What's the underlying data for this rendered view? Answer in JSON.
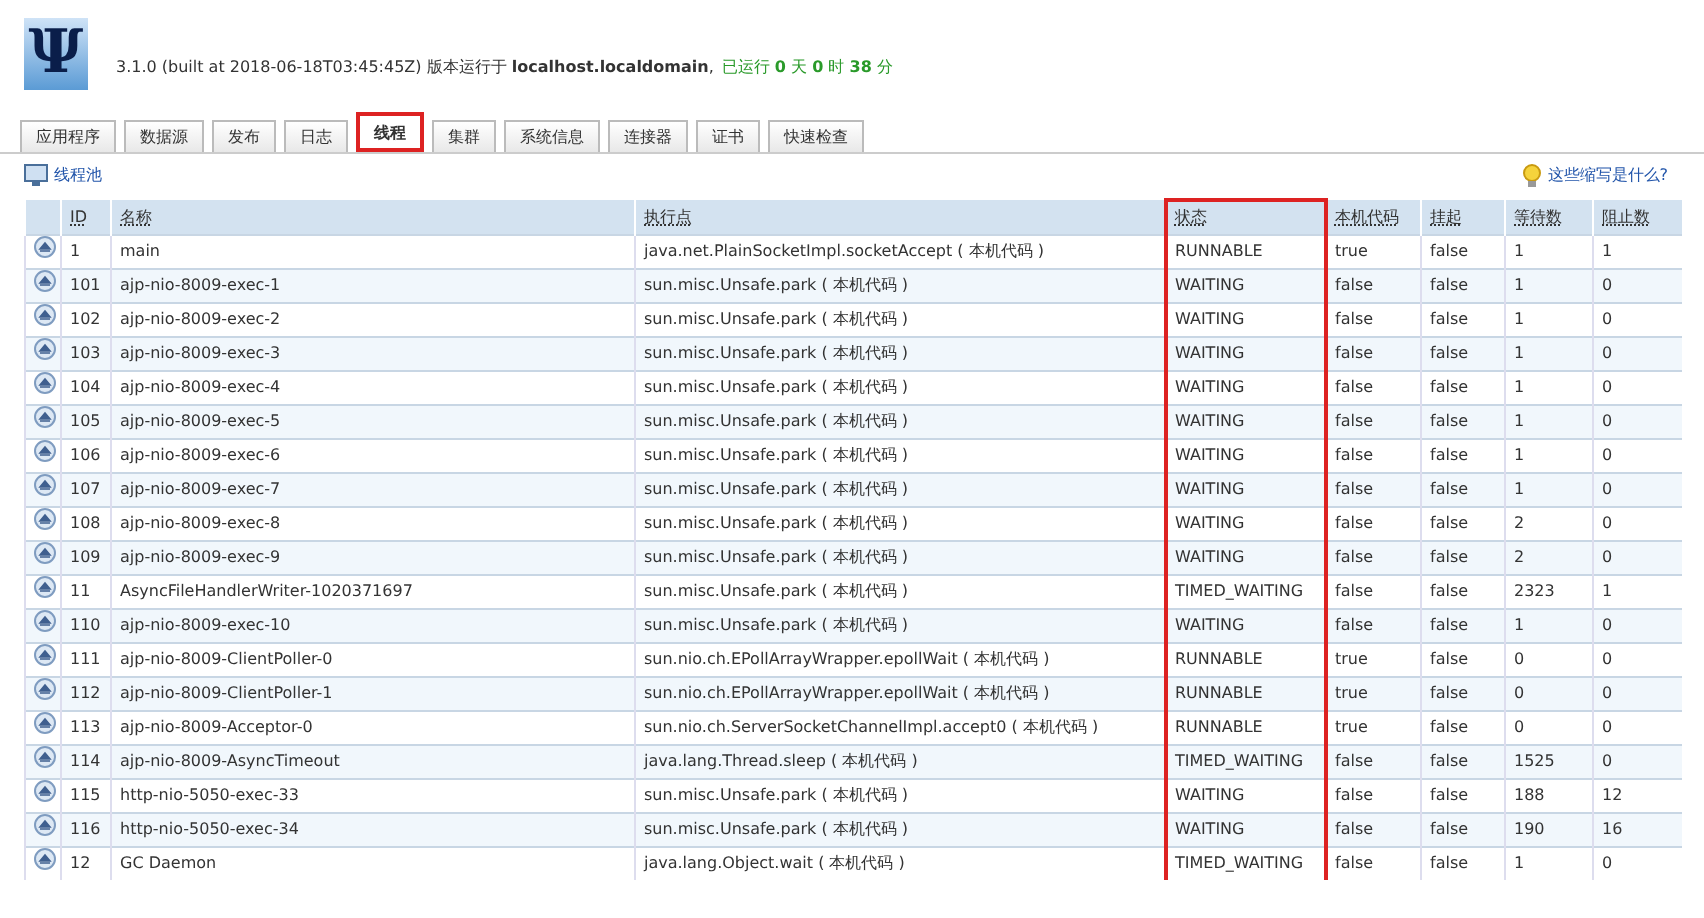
{
  "header": {
    "logo_glyph": "Ψ",
    "version": "3.1.0 (built at 2018-06-18T03:45:45Z) 版本运行于 **localhost.localdomain**,",
    "uptime": "已运行 **0** 天 **0** 时 **38** 分"
  },
  "tabs": [
    {
      "label": "应用程序",
      "selected": false
    },
    {
      "label": "数据源",
      "selected": false
    },
    {
      "label": "发布",
      "selected": false
    },
    {
      "label": "日志",
      "selected": false
    },
    {
      "label": "线程",
      "selected": true
    },
    {
      "label": "集群",
      "selected": false
    },
    {
      "label": "系统信息",
      "selected": false
    },
    {
      "label": "连接器",
      "selected": false
    },
    {
      "label": "证书",
      "selected": false
    },
    {
      "label": "快速检查",
      "selected": false
    }
  ],
  "toolbar": {
    "pool_link": "线程池",
    "help_link": "这些缩写是什么?"
  },
  "table": {
    "columns": [
      {
        "label": "ID",
        "highlighted": false
      },
      {
        "label": "名称",
        "highlighted": false
      },
      {
        "label": "执行点",
        "highlighted": false
      },
      {
        "label": "状态",
        "highlighted": true
      },
      {
        "label": "本机代码",
        "highlighted": false
      },
      {
        "label": "挂起",
        "highlighted": false
      },
      {
        "label": "等待数",
        "highlighted": false
      },
      {
        "label": "阻止数",
        "highlighted": false
      }
    ],
    "rows": [
      [
        "1",
        "main",
        "java.net.PlainSocketImpl.socketAccept ( 本机代码 )",
        "RUNNABLE",
        "true",
        "false",
        "1",
        "1"
      ],
      [
        "101",
        "ajp-nio-8009-exec-1",
        "sun.misc.Unsafe.park ( 本机代码 )",
        "WAITING",
        "false",
        "false",
        "1",
        "0"
      ],
      [
        "102",
        "ajp-nio-8009-exec-2",
        "sun.misc.Unsafe.park ( 本机代码 )",
        "WAITING",
        "false",
        "false",
        "1",
        "0"
      ],
      [
        "103",
        "ajp-nio-8009-exec-3",
        "sun.misc.Unsafe.park ( 本机代码 )",
        "WAITING",
        "false",
        "false",
        "1",
        "0"
      ],
      [
        "104",
        "ajp-nio-8009-exec-4",
        "sun.misc.Unsafe.park ( 本机代码 )",
        "WAITING",
        "false",
        "false",
        "1",
        "0"
      ],
      [
        "105",
        "ajp-nio-8009-exec-5",
        "sun.misc.Unsafe.park ( 本机代码 )",
        "WAITING",
        "false",
        "false",
        "1",
        "0"
      ],
      [
        "106",
        "ajp-nio-8009-exec-6",
        "sun.misc.Unsafe.park ( 本机代码 )",
        "WAITING",
        "false",
        "false",
        "1",
        "0"
      ],
      [
        "107",
        "ajp-nio-8009-exec-7",
        "sun.misc.Unsafe.park ( 本机代码 )",
        "WAITING",
        "false",
        "false",
        "1",
        "0"
      ],
      [
        "108",
        "ajp-nio-8009-exec-8",
        "sun.misc.Unsafe.park ( 本机代码 )",
        "WAITING",
        "false",
        "false",
        "2",
        "0"
      ],
      [
        "109",
        "ajp-nio-8009-exec-9",
        "sun.misc.Unsafe.park ( 本机代码 )",
        "WAITING",
        "false",
        "false",
        "2",
        "0"
      ],
      [
        "11",
        "AsyncFileHandlerWriter-1020371697",
        "sun.misc.Unsafe.park ( 本机代码 )",
        "TIMED_WAITING",
        "false",
        "false",
        "2323",
        "1"
      ],
      [
        "110",
        "ajp-nio-8009-exec-10",
        "sun.misc.Unsafe.park ( 本机代码 )",
        "WAITING",
        "false",
        "false",
        "1",
        "0"
      ],
      [
        "111",
        "ajp-nio-8009-ClientPoller-0",
        "sun.nio.ch.EPollArrayWrapper.epollWait ( 本机代码 )",
        "RUNNABLE",
        "true",
        "false",
        "0",
        "0"
      ],
      [
        "112",
        "ajp-nio-8009-ClientPoller-1",
        "sun.nio.ch.EPollArrayWrapper.epollWait ( 本机代码 )",
        "RUNNABLE",
        "true",
        "false",
        "0",
        "0"
      ],
      [
        "113",
        "ajp-nio-8009-Acceptor-0",
        "sun.nio.ch.ServerSocketChannelImpl.accept0 ( 本机代码 )",
        "RUNNABLE",
        "true",
        "false",
        "0",
        "0"
      ],
      [
        "114",
        "ajp-nio-8009-AsyncTimeout",
        "java.lang.Thread.sleep ( 本机代码 )",
        "TIMED_WAITING",
        "false",
        "false",
        "1525",
        "0"
      ],
      [
        "115",
        "http-nio-5050-exec-33",
        "sun.misc.Unsafe.park ( 本机代码 )",
        "WAITING",
        "false",
        "false",
        "188",
        "12"
      ],
      [
        "116",
        "http-nio-5050-exec-34",
        "sun.misc.Unsafe.park ( 本机代码 )",
        "WAITING",
        "false",
        "false",
        "190",
        "16"
      ],
      [
        "12",
        "GC Daemon",
        "java.lang.Object.wait ( 本机代码 )",
        "TIMED_WAITING",
        "false",
        "false",
        "1",
        "0"
      ]
    ]
  }
}
